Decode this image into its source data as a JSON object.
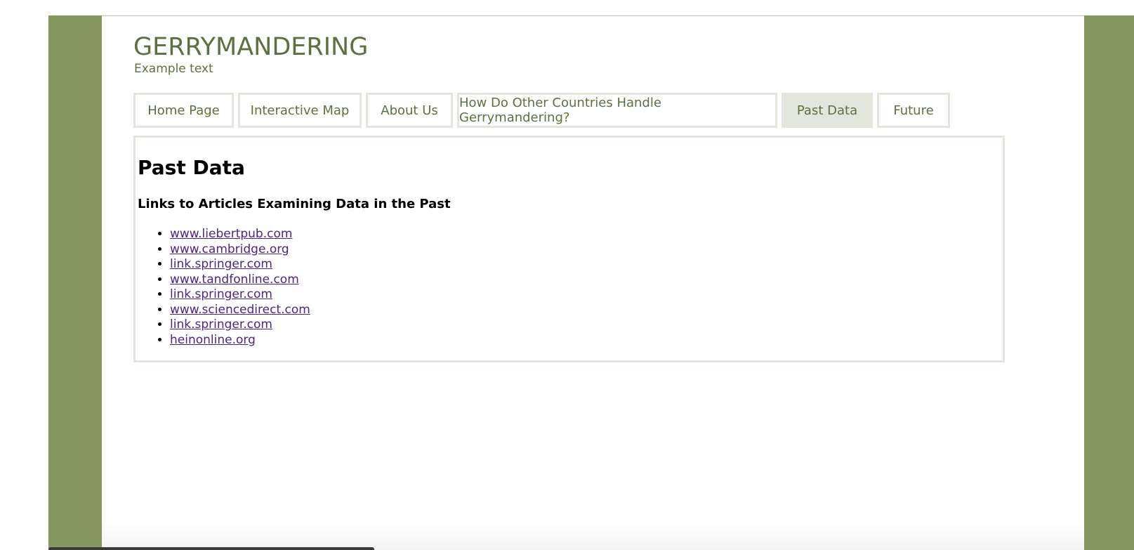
{
  "header": {
    "title": "GERRYMANDERING",
    "subtitle": "Example text"
  },
  "nav": {
    "items": [
      {
        "label": "Home Page"
      },
      {
        "label": "Interactive Map"
      },
      {
        "label": "About Us"
      },
      {
        "label": "How Do Other Countries Handle Gerrymandering?"
      },
      {
        "label": "Past Data"
      },
      {
        "label": "Future"
      }
    ],
    "active": "Past Data"
  },
  "main": {
    "title": "Past Data",
    "subtitle": "Links to Articles Examining Data in the Past",
    "links": [
      {
        "text": "www.liebertpub.com"
      },
      {
        "text": "www.cambridge.org"
      },
      {
        "text": "link.springer.com"
      },
      {
        "text": "www.tandfonline.com"
      },
      {
        "text": "link.springer.com"
      },
      {
        "text": "www.sciencedirect.com"
      },
      {
        "text": "link.springer.com"
      },
      {
        "text": "heinonline.org"
      }
    ]
  },
  "colors": {
    "frame": "#86965f",
    "accent_text": "#5f7040",
    "tab_border": "#e3e6dc",
    "link": "#4b2585"
  }
}
